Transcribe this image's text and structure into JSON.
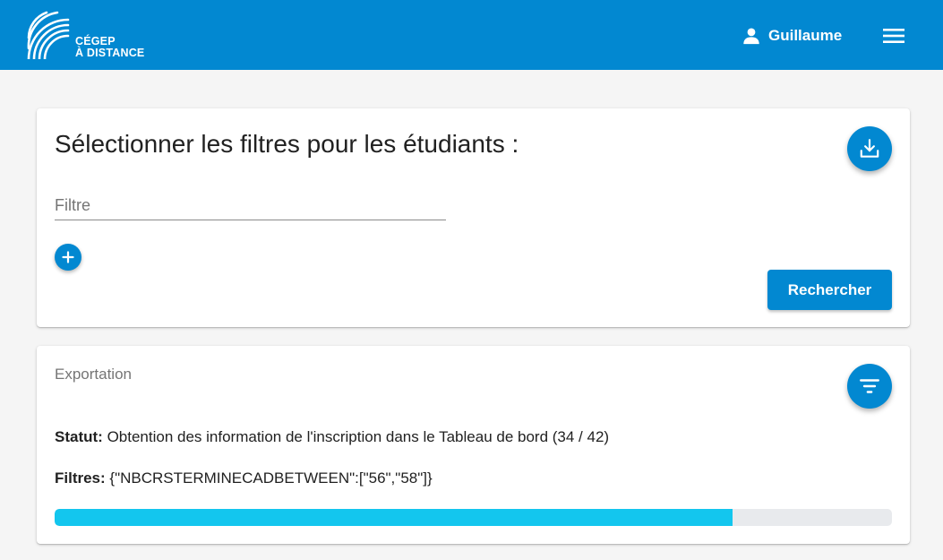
{
  "colors": {
    "primary": "#0288d1",
    "progress_fill": "#13c6ee",
    "progress_track": "#e8eaed",
    "background": "#f5f5f5"
  },
  "header": {
    "logo_line1": "CÉGEP",
    "logo_line2": "À DISTANCE",
    "user_icon": "person-icon",
    "user_name": "Guillaume",
    "menu_icon": "hamburger-menu-icon"
  },
  "filters_card": {
    "title": "Sélectionner les filtres pour les étudiants :",
    "download_icon": "download-icon",
    "filter_field": {
      "placeholder": "Filtre",
      "value": ""
    },
    "add_icon": "plus-icon",
    "search_button_label": "Rechercher"
  },
  "export_card": {
    "title": "Exportation",
    "filter_icon": "filter-list-icon",
    "status_label": "Statut:",
    "status_value": "Obtention des information de l'inscription dans le Tableau de bord (34 / 42)",
    "filters_label": "Filtres:",
    "filters_value": "{\"NBCRSTERMINECADBETWEEN\":[\"56\",\"58\"]}",
    "progress": {
      "current": 34,
      "total": 42
    }
  }
}
